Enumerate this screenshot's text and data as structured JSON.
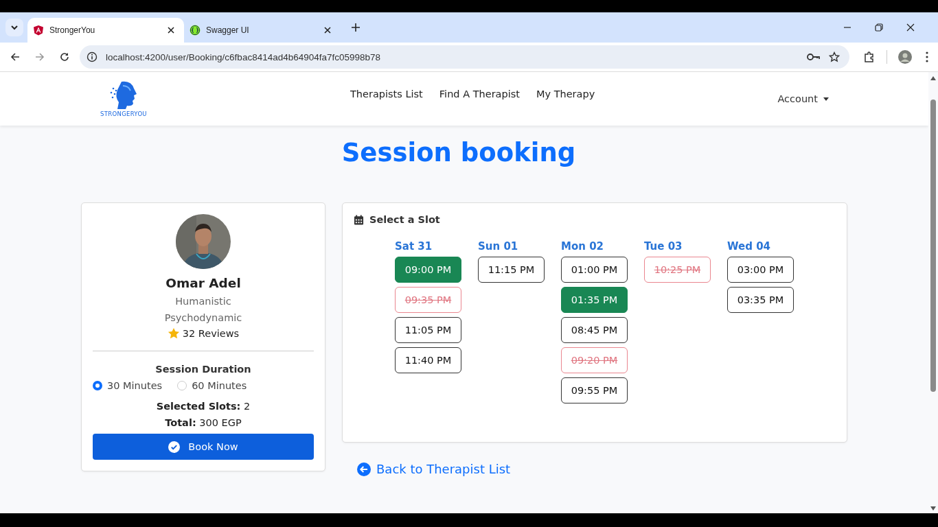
{
  "browser": {
    "tabs": [
      {
        "title": "StrongerYou",
        "selected": true
      },
      {
        "title": "Swagger UI",
        "selected": false
      }
    ],
    "url": "localhost:4200/user/Booking/c6fbac8414ad4b64904fa7fc05998b78"
  },
  "navbar": {
    "logo_text": "STRONGERYOU",
    "links": [
      "Therapists List",
      "Find A Therapist",
      "My Therapy"
    ],
    "account": "Account"
  },
  "page_title": "Session booking",
  "therapist": {
    "photo": {
      "kind": "picture"
    },
    "name": "Omar Adel",
    "specialties": [
      "Humanistic",
      "Psychodynamic"
    ],
    "reviews": "32 Reviews"
  },
  "duration": {
    "label": "Session Duration",
    "options": [
      {
        "label": "30 Minutes",
        "selected": true
      },
      {
        "label": "60 Minutes",
        "selected": false
      }
    ]
  },
  "summary": [
    {
      "label": "Selected Slots:",
      "value": "2"
    },
    {
      "label": "Total:",
      "value": "300 EGP"
    }
  ],
  "book_button": "Book Now",
  "slots_card": {
    "title": "Select a Slot",
    "days": [
      {
        "day": "Sat 31",
        "slots": [
          {
            "time": "09:00 PM",
            "selected": true,
            "disabled": false
          },
          {
            "time": "09:35 PM",
            "selected": false,
            "disabled": true
          },
          {
            "time": "11:05 PM",
            "selected": false,
            "disabled": false
          },
          {
            "time": "11:40 PM",
            "selected": false,
            "disabled": false
          }
        ]
      },
      {
        "day": "Sun 01",
        "slots": [
          {
            "time": "11:15 PM",
            "selected": false,
            "disabled": false
          }
        ]
      },
      {
        "day": "Mon 02",
        "slots": [
          {
            "time": "01:00 PM",
            "selected": false,
            "disabled": false
          },
          {
            "time": "01:35 PM",
            "selected": true,
            "disabled": false
          },
          {
            "time": "08:45 PM",
            "selected": false,
            "disabled": false
          },
          {
            "time": "09:20 PM",
            "selected": false,
            "disabled": true
          },
          {
            "time": "09:55 PM",
            "selected": false,
            "disabled": false
          }
        ]
      },
      {
        "day": "Tue 03",
        "slots": [
          {
            "time": "10:25 PM",
            "selected": false,
            "disabled": true
          }
        ]
      },
      {
        "day": "Wed 04",
        "slots": [
          {
            "time": "03:00 PM",
            "selected": false,
            "disabled": false
          },
          {
            "time": "03:35 PM",
            "selected": false,
            "disabled": false
          }
        ]
      }
    ]
  },
  "back_link": "Back to Therapist List"
}
